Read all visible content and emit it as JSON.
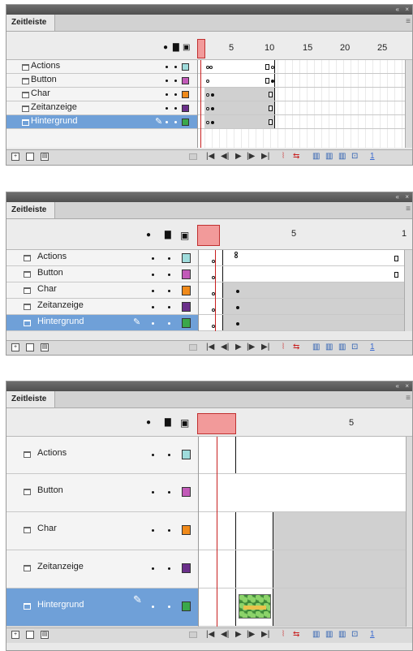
{
  "panel": {
    "tab_label": "Zeitleiste",
    "collapse_label": "«",
    "close_label": "×",
    "menu_label": "≡"
  },
  "layers": [
    "Actions",
    "Button",
    "Char",
    "Zeitanzeige",
    "Hintergrund"
  ],
  "selected_layer": "Hintergrund",
  "layer_colors": [
    "#9fdcdc",
    "#c25ab8",
    "#f08a1a",
    "#6a2f8a",
    "#3aa84a"
  ],
  "ruler_ticks_panel1": [
    "5",
    "10",
    "15",
    "20",
    "25"
  ],
  "ruler_ticks_panel2": [
    "5",
    "1"
  ],
  "ruler_ticks_panel3": [
    "5"
  ],
  "header_icons": [
    "eye-icon",
    "lock-icon",
    "outline-icon"
  ],
  "footer": {
    "frame_number": "1",
    "left_icons": [
      "new-layer-icon",
      "new-folder-icon",
      "delete-icon"
    ],
    "controls": [
      "first-frame-icon",
      "prev-frame-icon",
      "play-icon",
      "next-frame-icon",
      "last-frame-icon",
      "center-frame-icon",
      "loop-icon",
      "onion-skin-icon",
      "onion-outline-icon",
      "edit-multiple-icon",
      "onion-markers-icon"
    ]
  }
}
